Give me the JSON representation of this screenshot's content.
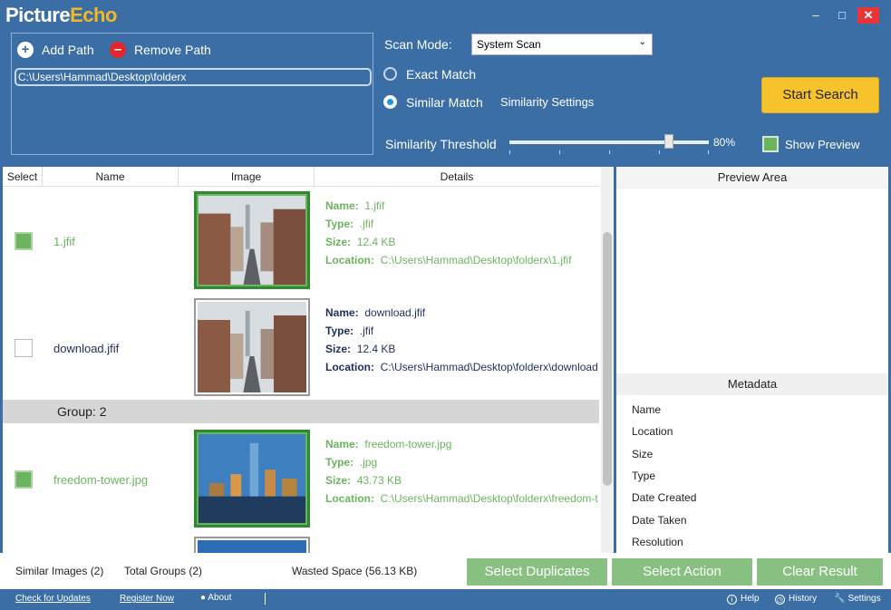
{
  "app": {
    "logo_main": "Picture",
    "logo_accent": "Echo",
    "window_controls": {
      "minimize": "–",
      "maximize": "□",
      "close": "✕"
    }
  },
  "paths": {
    "add_label": "Add Path",
    "remove_label": "Remove Path",
    "items": [
      "C:\\Users\\Hammad\\Desktop\\folderx"
    ]
  },
  "scan": {
    "mode_label": "Scan Mode:",
    "mode_value": "System Scan",
    "exact_label": "Exact Match",
    "similar_label": "Similar Match",
    "selected": "Similar Match",
    "settings_link": "Similarity Settings",
    "threshold_label": "Similarity Threshold",
    "threshold_value": 80,
    "threshold_text": "80%",
    "start_label": "Start Search",
    "show_preview_label": "Show Preview",
    "show_preview_checked": true
  },
  "table": {
    "columns": [
      "Select",
      "Name",
      "Image",
      "Details"
    ],
    "field_labels": {
      "name": "Name:",
      "type": "Type:",
      "size": "Size:",
      "location": "Location:"
    },
    "rows": [
      {
        "checked": true,
        "name": "1.jfif",
        "type": ".jfif",
        "size": "12.4 KB",
        "location": "C:\\Users\\Hammad\\Desktop\\folderx\\1.jfif"
      },
      {
        "checked": false,
        "name": "download.jfif",
        "type": ".jfif",
        "size": "12.4 KB",
        "location": "C:\\Users\\Hammad\\Desktop\\folderx\\download"
      },
      {
        "checked": true,
        "name": "freedom-tower.jpg",
        "type": ".jpg",
        "size": "43.73 KB",
        "location": "C:\\Users\\Hammad\\Desktop\\folderx\\freedom-t"
      }
    ],
    "group_label": "Group: 2"
  },
  "preview": {
    "title": "Preview Area"
  },
  "metadata": {
    "title": "Metadata",
    "fields": [
      "Name",
      "Location",
      "Size",
      "Type",
      "Date Created",
      "Date Taken",
      "Resolution"
    ]
  },
  "status": {
    "similar_images": "Similar Images (2)",
    "total_groups": "Total Groups (2)",
    "wasted_space": "Wasted Space (56.13 KB)",
    "select_duplicates": "Select Duplicates",
    "select_action": "Select Action",
    "clear_result": "Clear Result"
  },
  "footer": {
    "check_updates": "Check for Updates",
    "register": "Register Now",
    "about": "About",
    "help": "Help",
    "history": "History",
    "settings": "Settings"
  },
  "colors": {
    "brand_blue": "#3c6ea6",
    "accent_yellow": "#f6c32c",
    "selected_green": "#6cb35f",
    "action_green": "#88c081"
  }
}
